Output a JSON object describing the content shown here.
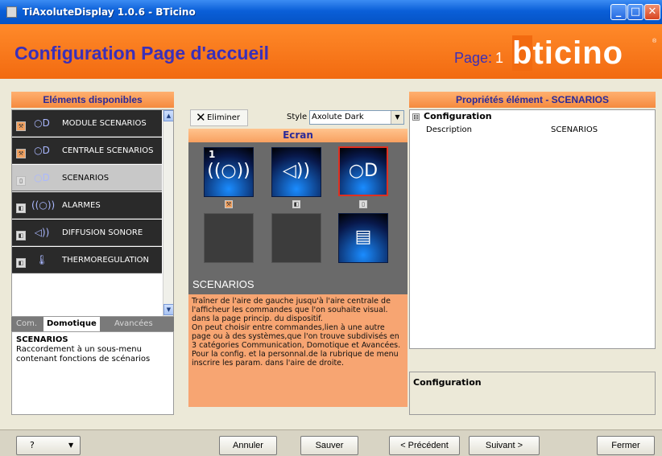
{
  "window": {
    "title": "TiAxoluteDisplay 1.0.6 - BTicino",
    "min_glyph": "_",
    "max_glyph": "□",
    "close_glyph": "✕"
  },
  "header": {
    "title": "Configuration Page d'accueil",
    "page_label": "Page:",
    "page_number": "1",
    "logo": "bticino",
    "logo_first_letter": "b",
    "logo_rest": "ticino",
    "logo_mark": "®"
  },
  "left_panel": {
    "heading": "Eléments disponibles",
    "items": [
      {
        "label": "MODULE SCENARIOS",
        "icon": "scenario-icon",
        "glyph": "○D",
        "category": "tool"
      },
      {
        "label": "CENTRALE SCENARIOS",
        "icon": "scenario-icon",
        "glyph": "○D",
        "category": "tool"
      },
      {
        "label": "SCENARIOS",
        "icon": "scenario-icon",
        "glyph": "○D",
        "category": "page",
        "selected": true
      },
      {
        "label": "ALARMES",
        "icon": "alarm-icon",
        "glyph": "((○))",
        "category": "domotique"
      },
      {
        "label": "DIFFUSION SONORE",
        "icon": "speaker-icon",
        "glyph": "◁))",
        "category": "domotique"
      },
      {
        "label": "THERMOREGULATION",
        "icon": "thermometer-icon",
        "glyph": "🌡",
        "category": "domotique"
      }
    ],
    "scroll_up": "▲",
    "scroll_down": "▼",
    "tabs": [
      "Com.",
      "Domotique",
      "Avancées"
    ],
    "active_tab": "Domotique",
    "description_title": "SCENARIOS",
    "description_text": "Raccordement à un sous-menu contenant fonctions de scénarios"
  },
  "middle_panel": {
    "delete_label": "Eliminer",
    "delete_glyph": "✕",
    "style_label": "Style",
    "style_value": "Axolute Dark",
    "dropdown_glyph": "▼",
    "screen_heading": "Ecran",
    "tiles": [
      {
        "icon": "intercom-icon",
        "glyph": "((○))",
        "number": "1",
        "badge": "tool"
      },
      {
        "icon": "speaker-icon",
        "glyph": "◁))",
        "badge": "domotique"
      },
      {
        "icon": "scenario-icon",
        "glyph": "○D",
        "badge": "page",
        "selected": true
      },
      {
        "icon": "empty-slot",
        "glyph": ""
      },
      {
        "icon": "empty-slot",
        "glyph": ""
      },
      {
        "icon": "pages-icon",
        "glyph": "▤"
      }
    ],
    "selected_name": "SCENARIOS",
    "help_text": "Traîner de l'aire de gauche jusqu'à l'aire centrale de l'afficheur les commandes que l'on souhaite visual. dans la page princip. du dispositif.\nOn peut choisir entre commandes,lien à une autre page ou à des systèmes,que l'on trouve subdivisés en 3 catégories Communication, Domotique et Avancées. Pour la config. et la personnal.de la rubrique de menu inscrire les param. dans l'aire de droite."
  },
  "right_panel": {
    "heading": "Propriétés élément - SCENARIOS",
    "group": "Configuration",
    "group_toggle": "⊟",
    "properties": [
      {
        "key": "Description",
        "value": "SCENARIOS"
      }
    ],
    "footer_title": "Configuration"
  },
  "bottom_bar": {
    "help_button": "?",
    "dropdown_glyph": "▼",
    "cancel": "Annuler",
    "save": "Sauver",
    "previous": "< Précédent",
    "next": "Suivant >",
    "close": "Fermer"
  },
  "colors": {
    "accent_orange": "#f26a10",
    "title_blue": "#3b2fb8",
    "selection_red": "#e03020",
    "help_bg": "#f7a572"
  }
}
